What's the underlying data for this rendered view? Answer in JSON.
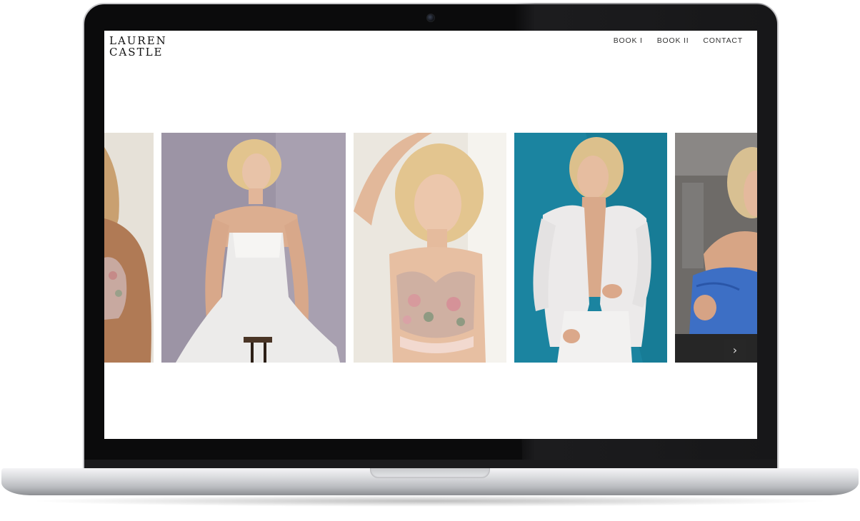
{
  "site": {
    "logo_line1": "LAUREN",
    "logo_line2": "CASTLE"
  },
  "nav": {
    "items": [
      {
        "label": "BOOK I"
      },
      {
        "label": "BOOK II"
      },
      {
        "label": "CONTACT"
      }
    ]
  },
  "gallery": {
    "photos": [
      {
        "description": "partial-photo-left"
      },
      {
        "description": "photo-white-jumpsuit"
      },
      {
        "description": "photo-floral-bra"
      },
      {
        "description": "photo-white-blazer-teal"
      },
      {
        "description": "photo-blue-top-partial"
      }
    ],
    "next_icon": "chevron-right-icon",
    "next_glyph": "›"
  }
}
